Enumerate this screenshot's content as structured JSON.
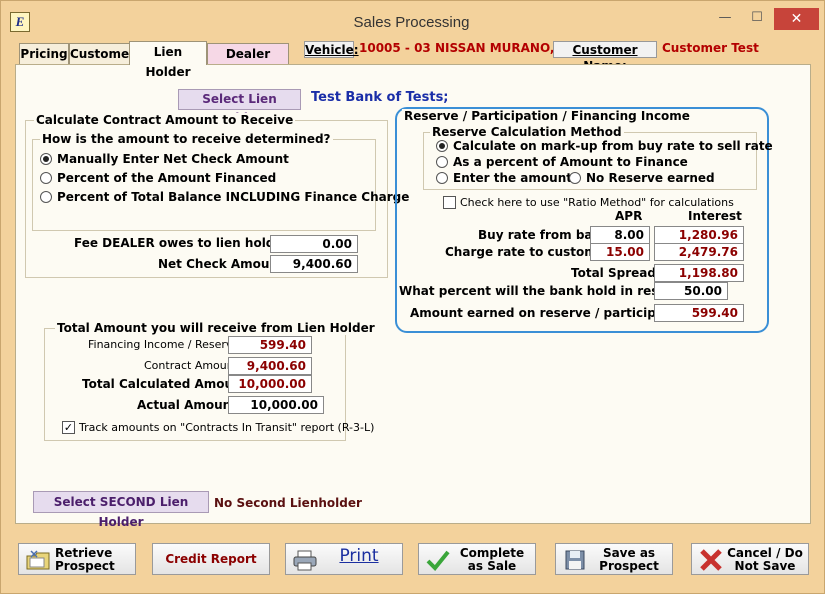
{
  "window": {
    "title": "Sales Processing",
    "icon_text": "E",
    "minimize": "—",
    "maximize": "☐",
    "close": "✕"
  },
  "tabs": [
    {
      "label": "Pricing"
    },
    {
      "label": "Customer"
    },
    {
      "label": "Lien Holder"
    },
    {
      "label": "Dealer Costs"
    }
  ],
  "header": {
    "vehicle_label": "Vehicle:",
    "vehicle_value": "10005 - 03 NISSAN MURANO,",
    "customer_label": "Customer Name:",
    "customer_value": "Customer Test"
  },
  "lien": {
    "select_label": "Select Lien Holder",
    "bank_name": "Test Bank of Tests;"
  },
  "calc": {
    "title": "Calculate Contract Amount to Receive",
    "question": "How is the amount to receive determined?",
    "options": [
      "Manually Enter Net Check Amount",
      "Percent of the Amount Financed",
      "Percent of Total Balance INCLUDING Finance Charge"
    ],
    "selected": 0,
    "fee_label": "Fee DEALER owes to lien holder:",
    "fee_value": "0.00",
    "net_label": "Net Check Amount:",
    "net_value": "9,400.60"
  },
  "total": {
    "title": "Total Amount you will receive from Lien Holder",
    "rows": [
      {
        "label": "Financing Income / Reserve:",
        "value": "599.40",
        "bold": false,
        "red": true
      },
      {
        "label": "Contract Amount:",
        "value": "9,400.60",
        "bold": false,
        "red": true
      },
      {
        "label": "Total Calculated Amount:",
        "value": "10,000.00",
        "bold": true,
        "red": true
      },
      {
        "label": "Actual Amount:",
        "value": "10,000.00",
        "bold": true,
        "red": false
      }
    ],
    "track_label": "Track amounts on \"Contracts In Transit\" report (R-3-L)",
    "track_checked": true
  },
  "second": {
    "select_label": "Select SECOND Lien Holder",
    "value": "No Second Lienholder"
  },
  "reserve": {
    "title": "Reserve / Participation / Financing Income",
    "method_title": "Reserve Calculation Method",
    "methods": [
      "Calculate on mark-up from buy rate to sell rate",
      "As a percent of Amount to Finance",
      "Enter the amount",
      "No Reserve earned"
    ],
    "selected": 0,
    "ratio_label": "Check here to use \"Ratio Method\" for calculations",
    "ratio_checked": false,
    "col_apr": "APR",
    "col_interest": "Interest",
    "buy_label": "Buy rate from bank:",
    "buy_apr": "8.00",
    "buy_interest": "1,280.96",
    "charge_label": "Charge rate to customer:",
    "charge_apr": "15.00",
    "charge_interest": "2,479.76",
    "spread_label": "Total Spread:",
    "spread_value": "1,198.80",
    "hold_label": "What percent will the bank hold in reserve?",
    "hold_value": "50.00",
    "earned_label": "Amount earned on reserve / participation:",
    "earned_value": "599.40"
  },
  "buttons": {
    "retrieve": "Retrieve Prospect",
    "credit": "Credit Report",
    "print": "Print",
    "complete": "Complete as Sale",
    "save": "Save as Prospect",
    "cancel": "Cancel / Do Not Save"
  }
}
